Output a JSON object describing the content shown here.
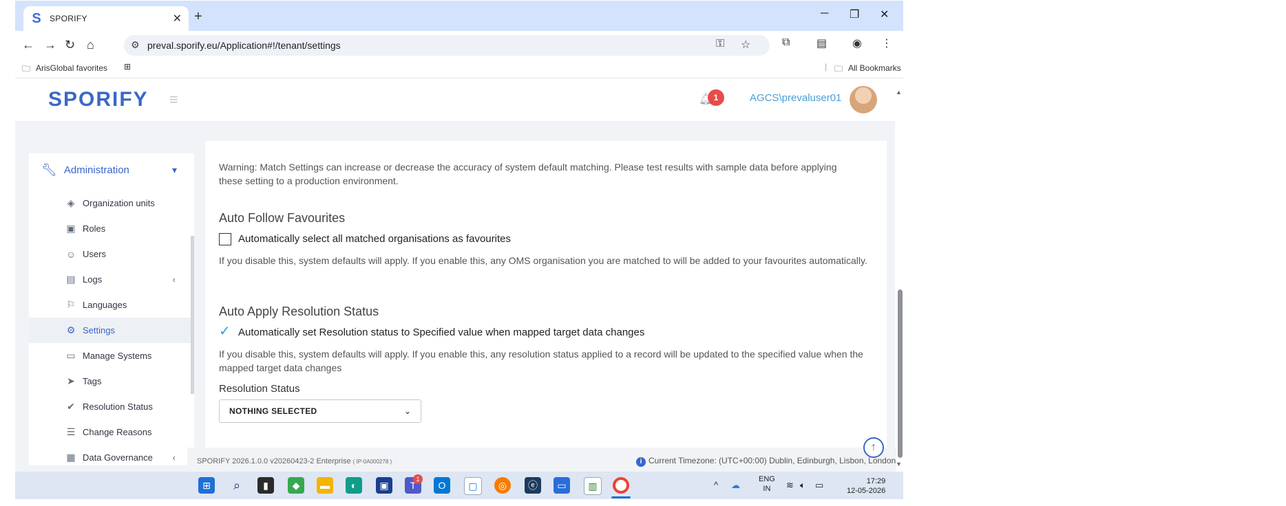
{
  "browser": {
    "tab_title": "SPORIFY",
    "tab_logo": "S",
    "url": "preval.sporify.eu/Application#!/tenant/settings",
    "bookmarks_left": "ArisGlobal favorites",
    "bookmarks_right": "All Bookmarks"
  },
  "app": {
    "logo": "SPORIFY",
    "notification_count": "1",
    "username": "AGCS\\prevaluser01"
  },
  "sidebar": {
    "section_label": "Administration",
    "items": [
      {
        "label": "Organization units",
        "icon": "layers-icon"
      },
      {
        "label": "Roles",
        "icon": "id-card-icon"
      },
      {
        "label": "Users",
        "icon": "users-icon"
      },
      {
        "label": "Logs",
        "icon": "logs-icon"
      },
      {
        "label": "Languages",
        "icon": "flag-icon"
      },
      {
        "label": "Settings",
        "icon": "gear-icon"
      },
      {
        "label": "Manage Systems",
        "icon": "laptop-icon"
      },
      {
        "label": "Tags",
        "icon": "tags-icon"
      },
      {
        "label": "Resolution Status",
        "icon": "check-icon"
      },
      {
        "label": "Change Reasons",
        "icon": "list-icon"
      },
      {
        "label": "Data Governance",
        "icon": "governance-icon"
      }
    ]
  },
  "main": {
    "warning": "Warning: Match Settings can increase or decrease the accuracy of system default matching. Please test results with sample data before applying these setting to a production environment.",
    "auto_follow": {
      "title": "Auto Follow Favourites",
      "checkbox_label": "Automatically select all matched organisations as favourites",
      "checked": false,
      "help": "If you disable this, system defaults will apply. If you enable this, any OMS organisation you are matched to will be added to your favourites automatically."
    },
    "auto_apply": {
      "title": "Auto Apply Resolution Status",
      "checkbox_label": "Automatically set Resolution status to Specified value when mapped target data changes",
      "checked": true,
      "help": "If you disable this, system defaults will apply. If you enable this, any resolution status applied to a record will be updated to the specified value when the mapped target data changes",
      "field_label": "Resolution Status",
      "select_value": "NOTHING SELECTED"
    }
  },
  "footer": {
    "version": "SPORIFY 2026.1.0.0 v20260423-2 Enterprise",
    "build": "( IP-0A000278 )",
    "timezone": "Current Timezone: (UTC+00:00) Dublin, Edinburgh, Lisbon, London"
  },
  "taskbar": {
    "lang_top": "ENG",
    "lang_bottom": "IN",
    "time": "17:29",
    "date": "12-05-2026",
    "teams_badge": "1"
  },
  "colors": {
    "accent": "#3a67c9",
    "link": "#4a9fd8",
    "badge": "#e74c4c",
    "check": "#2f9fd7"
  }
}
